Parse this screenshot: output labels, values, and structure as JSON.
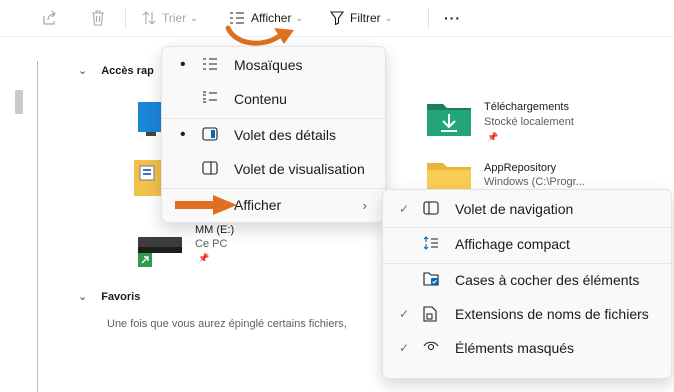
{
  "toolbar": {
    "sort_label": "Trier",
    "view_label": "Afficher",
    "filter_label": "Filtrer",
    "more_label": "···"
  },
  "content": {
    "quick_access_header": "Accès rap",
    "downloads": {
      "name": "Téléchargements",
      "sub": "Stocké localement"
    },
    "apprepo": {
      "name": "AppRepository",
      "sub": "Windows (C:\\Progr..."
    },
    "drive": {
      "name": "MM (E:)",
      "sub": "Ce PC"
    },
    "favorites_header": "Favoris",
    "favorites_hint": "Une fois que vous aurez épinglé certains fichiers,"
  },
  "view_menu": {
    "items": [
      {
        "label": "Mosaïques",
        "icon": "tiles-icon",
        "selected": true
      },
      {
        "label": "Contenu",
        "icon": "content-icon",
        "selected": false
      },
      {
        "label": "Volet des détails",
        "icon": "details-pane-icon",
        "selected": true
      },
      {
        "label": "Volet de visualisation",
        "icon": "preview-pane-icon",
        "selected": false
      },
      {
        "label": "Afficher",
        "icon": "",
        "submenu": true
      }
    ]
  },
  "show_submenu": {
    "items": [
      {
        "label": "Volet de navigation",
        "icon": "navigation-pane-icon",
        "checked": true
      },
      {
        "label": "Affichage compact",
        "icon": "compact-view-icon",
        "checked": false
      },
      {
        "label": "Cases à cocher des éléments",
        "icon": "item-checkbox-icon",
        "checked": false
      },
      {
        "label": "Extensions de noms de fichiers",
        "icon": "file-extension-icon",
        "checked": true
      },
      {
        "label": "Éléments masqués",
        "icon": "hidden-items-icon",
        "checked": true
      }
    ]
  },
  "colors": {
    "accent": "#0067c0",
    "annotation_arrow": "#e07020",
    "downloads_folder": "#1d9e72",
    "folder_yellow": "#f5c242"
  }
}
